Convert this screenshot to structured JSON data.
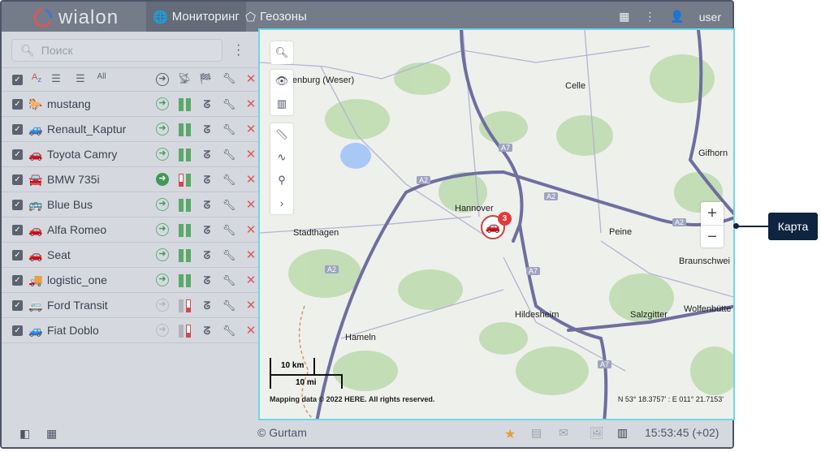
{
  "app": {
    "logo": "wialon",
    "tabs": [
      {
        "label": "Мониторинг",
        "icon": "globe-icon",
        "active": true
      },
      {
        "label": "Геозоны",
        "icon": "geofence-icon"
      }
    ],
    "user": "user"
  },
  "sidebar": {
    "search_placeholder": "Поиск",
    "units": [
      {
        "name": "mustang",
        "icon": "🐎",
        "state": "active"
      },
      {
        "name": "Renault_Kaptur",
        "icon": "🚙",
        "state": "active"
      },
      {
        "name": "Toyota Camry",
        "icon": "🚗",
        "state": "active"
      },
      {
        "name": "BMW 735i",
        "icon": "🚘",
        "state": "key"
      },
      {
        "name": "Blue Bus",
        "icon": "🚌",
        "state": "active"
      },
      {
        "name": "Alfa Romeo",
        "icon": "🚗",
        "state": "active"
      },
      {
        "name": "Seat",
        "icon": "🚗",
        "state": "active"
      },
      {
        "name": "logistic_one",
        "icon": "🚚",
        "state": "active"
      },
      {
        "name": "Ford Transit",
        "icon": "🚐",
        "state": "inactive"
      },
      {
        "name": "Fiat Doblo",
        "icon": "🚙",
        "state": "inactive"
      }
    ]
  },
  "map": {
    "labels": {
      "nienburg": "enburg (Weser)",
      "celle": "Celle",
      "gifhorn": "Gifhorn",
      "hannover": "Hannover",
      "stadthagen": "Stadthagen",
      "peine": "Peine",
      "braunschweig": "Braunschwei",
      "hildesheim": "Hildesheim",
      "salzgitter": "Salzgitter",
      "wolfenbuttel": "Wolfenbütte",
      "hameln": "Hameln"
    },
    "roads": {
      "a2": "A2",
      "a7": "A7"
    },
    "cluster_count": "3",
    "scale_km": "10 km",
    "scale_mi": "10 mi",
    "copyright": "Mapping data © 2022 HERE. All rights reserved.",
    "coords": "N 53° 18.3757' : E 011° 21.7153'"
  },
  "footer": {
    "copyright": "© Gurtam",
    "time": "15:53:45 (+02)"
  },
  "callout": "Карта",
  "colors": {
    "accent": "#6dd8e4",
    "callout": "#0e2440",
    "favorite": "#e0a040"
  }
}
